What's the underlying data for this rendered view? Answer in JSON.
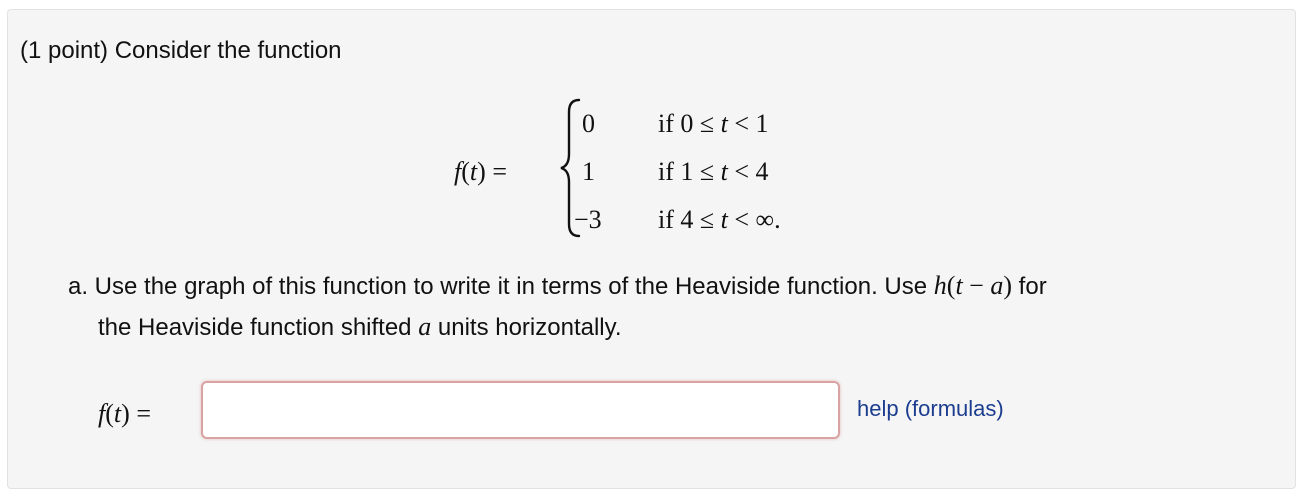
{
  "problem": {
    "intro": "(1 point) Consider the function",
    "function_lhs": {
      "f": "f",
      "open": "(",
      "t": "t",
      "close": ")",
      "eq": "="
    },
    "pieces": [
      {
        "value": "0",
        "cond_if": "if 0 ≤ ",
        "cond_var": "t",
        "cond_tail": " < 1"
      },
      {
        "value": "1",
        "cond_if": "if 1 ≤ ",
        "cond_var": "t",
        "cond_tail": " < 4"
      },
      {
        "value": "−3",
        "cond_if": "if 4 ≤ ",
        "cond_var": "t",
        "cond_tail": " < ∞."
      }
    ],
    "part_a": {
      "text1": "a. Use the graph of this function to write it in terms of the Heaviside function. Use ",
      "h_expr_h": "h",
      "h_expr_open": "(",
      "h_expr_t": "t",
      "h_expr_minus": " − ",
      "h_expr_a": "a",
      "h_expr_close": ")",
      "text2": " for",
      "text3": "the Heaviside function shifted ",
      "a_var": "a",
      "text4": " units horizontally."
    },
    "answer": {
      "lhs": {
        "f": "f",
        "open": "(",
        "t": "t",
        "close": ")",
        "eq": "="
      },
      "value": "",
      "placeholder": ""
    },
    "help_link": "help (formulas)"
  }
}
